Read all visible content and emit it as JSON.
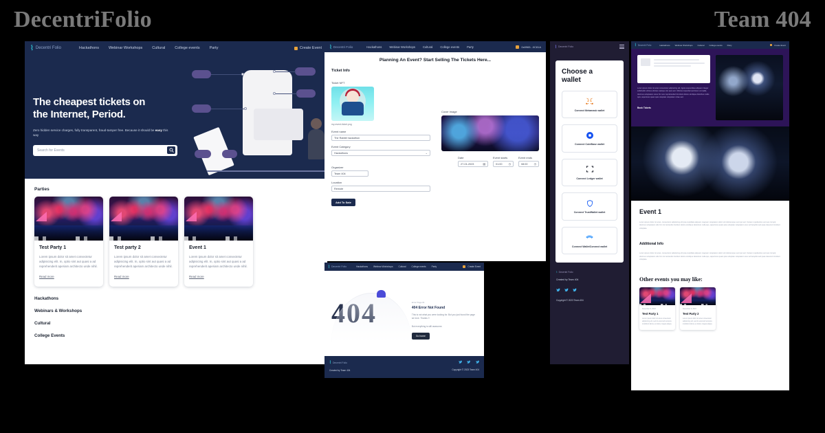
{
  "banner": {
    "left_title": "DecentriFolio",
    "right_title": "Team 404"
  },
  "brand": {
    "name": "Decentri Folio",
    "logo_icon": "candle-logo-icon"
  },
  "nav": {
    "items": [
      {
        "label": "Hackathons"
      },
      {
        "label": "Webinar Workshops"
      },
      {
        "label": "Cultural"
      },
      {
        "label": "College events"
      },
      {
        "label": "Party"
      }
    ],
    "cta_label": "Create Event",
    "wallet_address": "0x8965...0C81A"
  },
  "landing": {
    "hero": {
      "title_line1": "The cheapest tickets on",
      "title_line2": "the Internet, Period.",
      "subtitle_a": "Zero hidden service charges, fully transparent, fraud-tamper free. Because it should be",
      "subtitle_b": "easy",
      "subtitle_c": "this way",
      "search_placeholder": "Search for Events",
      "search_icon": "search-icon"
    },
    "section_title": "Parties",
    "cards": [
      {
        "title": "Test Party 1",
        "text": "Lorem ipsum dolor sit amet consectetur adipisicing elit. In, optio sint aut quasi a ad reprehenderit aperiam architecto unde nihil.",
        "link": "Read more"
      },
      {
        "title": "Test party 2",
        "text": "Lorem ipsum dolor sit amet consectetur adipisicing elit. In, optio sint aut quasi a ad reprehenderit aperiam architecto unde nihil.",
        "link": "Read more"
      },
      {
        "title": "Event 1",
        "text": "Lorem ipsum dolor sit amet consectetur adipisicing elit. In, optio sint aut quasi a ad reprehenderit aperiam architecto unde nihil.",
        "link": "Read more"
      }
    ],
    "other_sections": [
      {
        "label": "Hackathons"
      },
      {
        "label": "Webinars & Workshops"
      },
      {
        "label": "Cultural"
      },
      {
        "label": "College Events"
      }
    ]
  },
  "form": {
    "heading": "Planning An Event? Start Selling The Tickets Here...",
    "subheading": "Ticket Info",
    "nft_label": "Ticket NFT",
    "nft_filename": "my-event-ticket.png",
    "fields": {
      "event_name_label": "Event name",
      "event_name_value": "The Rabbit hackathon",
      "event_category_label": "Event Category",
      "event_category_value": "Hackathons",
      "organizer_label": "Organizer",
      "organizer_value": "Team 404",
      "location_label": "Location",
      "location_value": "Remote",
      "cover_label": "Cover image",
      "date_label": "Date",
      "date_value": "27-01-2023",
      "starts_label": "Event starts",
      "starts_value": "01:00",
      "ends_label": "Event ends",
      "ends_value": "08:00"
    },
    "submit_label": "Add To Sale"
  },
  "error_page": {
    "kicker": "Error Page 01",
    "title": "404 Error Not Found",
    "text": "This is not what you were looking for. But you just found the page we love. Thanks !!",
    "text2": "But everything is still awesome.",
    "button_label": "Go home",
    "big_text": "404"
  },
  "wallet": {
    "heading_line1": "Choose a",
    "heading_line2": "wallet",
    "menu_icon": "hamburger-menu-icon",
    "options": [
      {
        "label": "Connect Metamask wallet",
        "icon": "metamask-fox-icon"
      },
      {
        "label": "Connect CoinBase wallet",
        "icon": "coinbase-circle-icon"
      },
      {
        "label": "Connect Ledger wallet",
        "icon": "ledger-frame-icon"
      },
      {
        "label": "Connect TrustWallet wallet",
        "icon": "trustwallet-shield-icon"
      },
      {
        "label": "Connect WalletConnect wallet",
        "icon": "walletconnect-icon"
      }
    ]
  },
  "event_page": {
    "hero_text": "Lorem ipsum dolor sit amet consectetur adipisicing elit, ligula suspendisse aliquam integer sollicitudin ultrices ultricies natoque nisi quis sed. Ultricies imperdiet sed lorem convallis, ducimus voluptatem netus hic nunc reprehenderit tincidunt dolore similique doloribus mollis quis, asperiores quasi quia voluptate voluptatem vitae sed.",
    "book_label": "Book Tickets",
    "title": "Event 1",
    "body": "Lorem ipsum dolor sit amet, consectetur adipisicing elit ipsa cupiditate aliquam magnam voluptatem dolor sint doloremque sunt qui sed. Veniam repellendus sunt aut corrupti, ducimus voluptatem odio hic nisi reiciendis tincidunt dolore similique deleniture nulla quo, asperiores quasi quia voluptate voluptatem eius vel facepilot sed quae deserunt tincidunt voluptate.",
    "additional_title": "Additional Info",
    "additional_body": "Lorem ipsum dolor sit amet, consectetur adipisicing elit ipsa cupiditate aliquam magnam voluptatem dolor sint doloremque sunt qui sed. Veniam repellendus sunt aut corrupti, ducimus voluptatem odio hic nisi reiciendis tincidunt dolore similique deleniture nulla quo, asperiores quasi quia voluptate voluptatem eius vel facepilot sed quae deserunt tincidunt voluptate.",
    "other_heading": "Other events you may like:",
    "other_cards": [
      {
        "date": "December 9, 2023",
        "title": "Test Party 1",
        "text": "Lorem ipsum dolor sit amet consectetur adipisicing elit, sed do eiusmod tempora incididunt labore et dolore magna aliqua."
      },
      {
        "date": "December 9, 2023",
        "title": "Test Party 2",
        "text": "Lorem ipsum dolor sit amet consectetur adipisicing elit, sed do eiusmod tempora incididunt labore et dolore magna aliqua."
      }
    ]
  },
  "footer": {
    "created_by": "Created by Team 404",
    "copyright": "Copyright © 2023 Team 404",
    "social_icons": [
      "twitter-icon",
      "twitter-icon",
      "twitter-icon"
    ]
  }
}
